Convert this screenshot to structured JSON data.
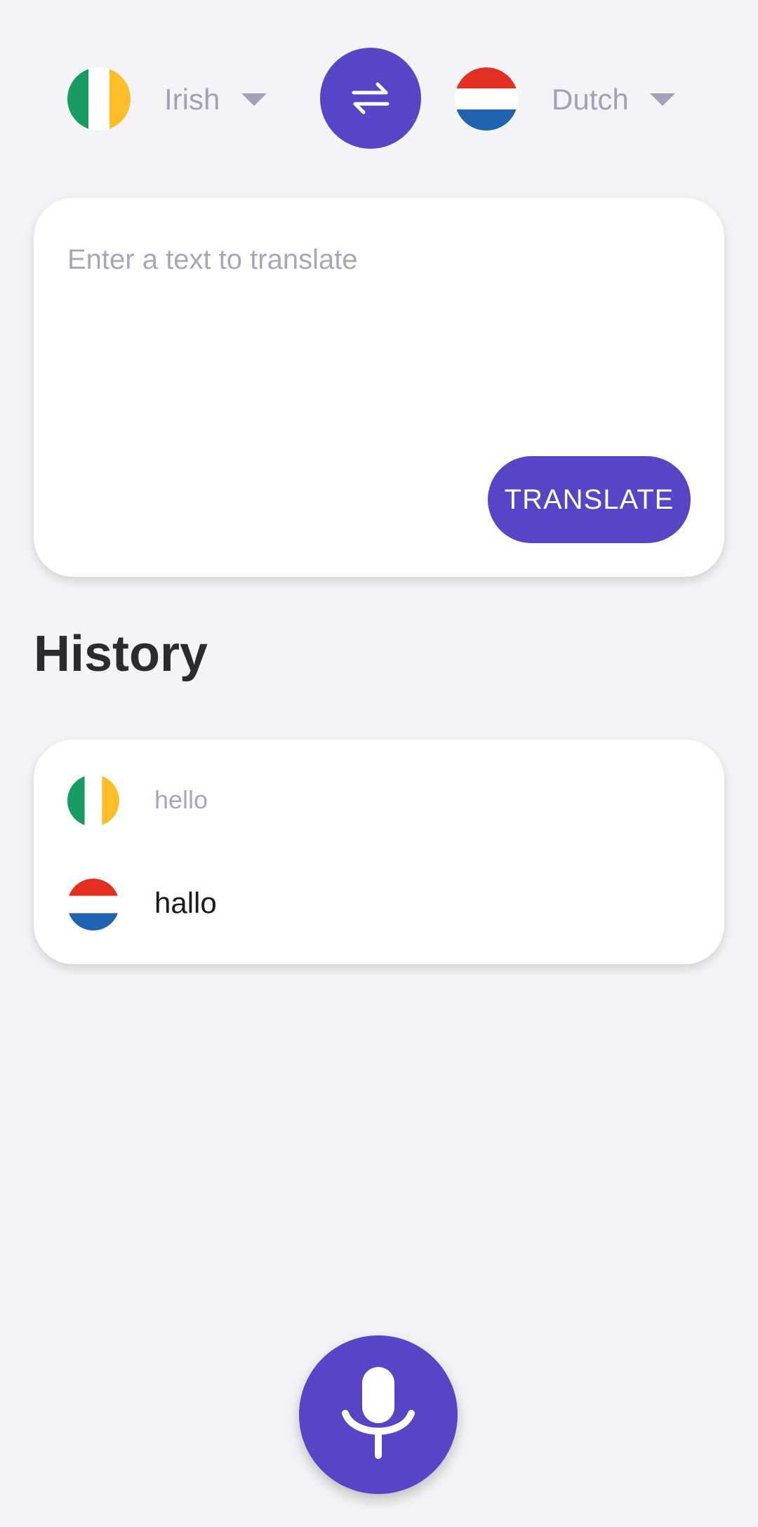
{
  "source_language": {
    "label": "Irish",
    "flag_icon": "ireland-flag-icon"
  },
  "target_language": {
    "label": "Dutch",
    "flag_icon": "netherlands-flag-icon"
  },
  "swap_icon": "swap-arrows-icon",
  "input": {
    "placeholder": "Enter a text to translate",
    "value": ""
  },
  "translate_button": {
    "label": "TRANSLATE"
  },
  "history": {
    "title": "History",
    "items": [
      {
        "source_text": "hello",
        "translated_text": "hallo"
      }
    ]
  },
  "mic_icon": "microphone-icon",
  "colors": {
    "accent": "#5745c8",
    "background": "#f4f3f5",
    "card": "#ffffff",
    "muted_text": "#a4a1b6"
  }
}
